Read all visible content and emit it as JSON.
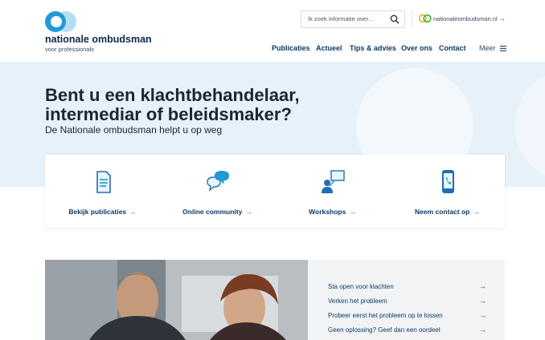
{
  "header": {
    "logo_name": "nationale ombudsman",
    "logo_sub": "voor professionals",
    "search_placeholder": "Ik zoek informatie over...",
    "external_link": "nationaleombudsman.nl",
    "external_arrow": "→",
    "nav": [
      "Publicaties",
      "Actueel",
      "Tips & advies",
      "Over ons",
      "Contact"
    ],
    "menu_label": "Meer"
  },
  "hero": {
    "title": "Bent u een klachtbehandelaar, intermediar of beleidsmaker?",
    "subtitle": "De Nationale ombudsman helpt u op weg"
  },
  "cards": [
    {
      "label": "Bekijk publicaties",
      "icon": "document-icon"
    },
    {
      "label": "Online community",
      "icon": "chat-bubbles-icon"
    },
    {
      "label": "Workshops",
      "icon": "presenter-icon"
    },
    {
      "label": "Neem contact op",
      "icon": "phone-icon"
    }
  ],
  "card_arrow": "→",
  "links": [
    "Sta open voor klachten",
    "Verken het probleem",
    "Probeer eerst het probleem op te lossen",
    "Geen oplossing? Geef dan een oordeel"
  ],
  "link_arrow": "→",
  "colors": {
    "brand_blue": "#1f9ad6",
    "navy": "#0e3a66",
    "hero_bg": "#e7f1f9"
  }
}
